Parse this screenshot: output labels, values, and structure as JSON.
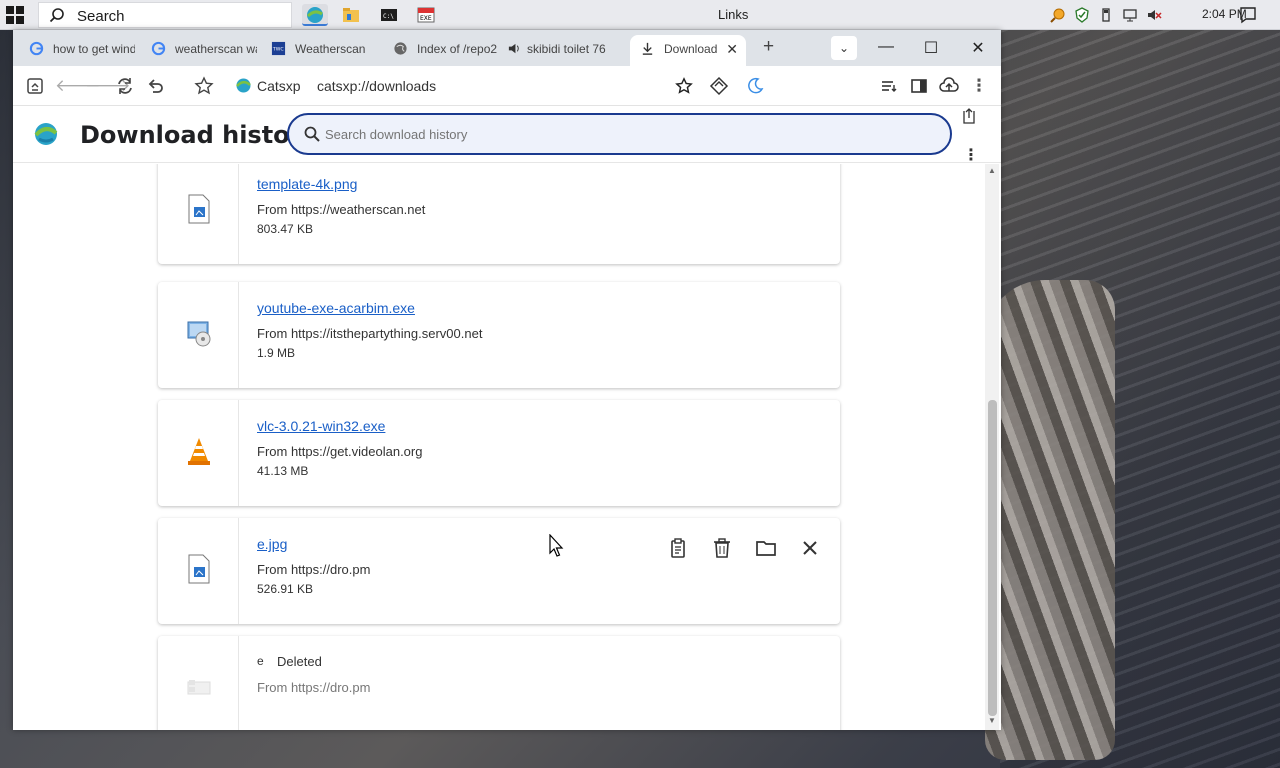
{
  "taskbar": {
    "search_placeholder": "Search",
    "window_title": "Links",
    "clock": "2:04 PM"
  },
  "browser": {
    "tabs": [
      {
        "label": "how to get wind",
        "icon": "google-icon"
      },
      {
        "label": "weatherscan wa",
        "icon": "google-icon"
      },
      {
        "label": "Weatherscan",
        "icon": "weatherchannel-icon"
      },
      {
        "label": "Index of /repo2",
        "icon": "globe-icon"
      },
      {
        "label": "skibidi toilet 76",
        "icon": "audio-icon"
      },
      {
        "label": "Download",
        "icon": "download-icon",
        "active": true
      }
    ],
    "address": {
      "site_name": "Catsxp",
      "url": "catsxp://downloads"
    }
  },
  "downloads": {
    "title": "Download history",
    "search_placeholder": "Search download history",
    "items": [
      {
        "filename": "template-4k.png",
        "from": "From https://weatherscan.net",
        "size": "803.47 KB",
        "icon": "image-file-icon"
      },
      {
        "filename": "youtube-exe-acarbim.exe",
        "from": "From https://itsthepartything.serv00.net",
        "size": "1.9 MB",
        "icon": "installer-icon"
      },
      {
        "filename": "vlc-3.0.21-win32.exe",
        "from": "From https://get.videolan.org",
        "size": "41.13 MB",
        "icon": "vlc-cone-icon"
      },
      {
        "filename": "e.jpg",
        "from": "From https://dro.pm",
        "size": "526.91 KB",
        "icon": "image-file-icon"
      },
      {
        "filename": "e",
        "state": "Deleted",
        "from": "From https://dro.pm",
        "icon": "deleted-file-icon"
      }
    ]
  },
  "colors": {
    "link": "#1a5fc7",
    "search_border": "#1a3a8f",
    "tab_strip": "#dfe3e8"
  }
}
